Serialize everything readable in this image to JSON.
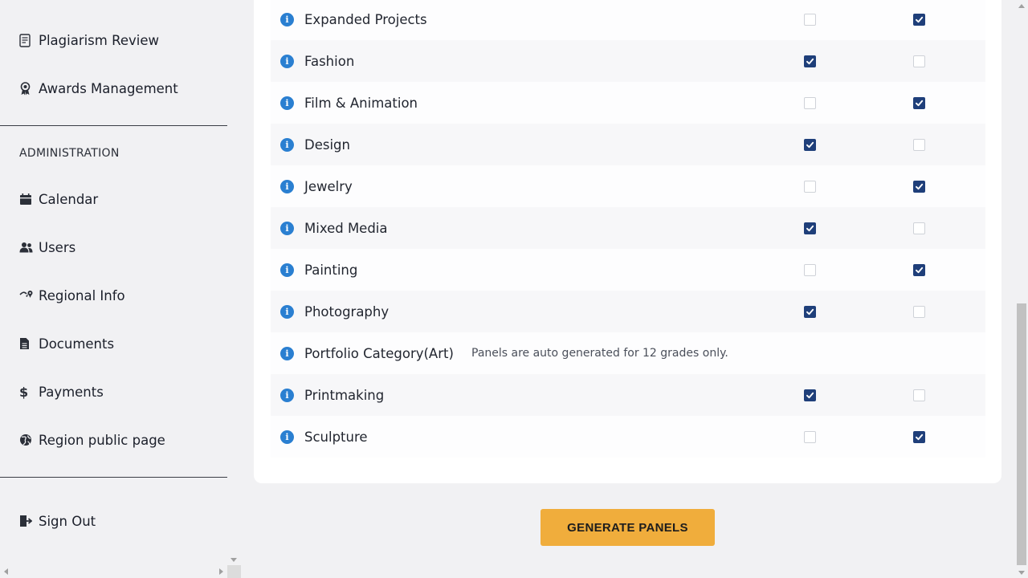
{
  "sidebar": {
    "top_items": [
      {
        "label": "Plagiarism Review",
        "icon": "document-check-icon"
      },
      {
        "label": "Awards Management",
        "icon": "award-ribbon-icon"
      }
    ],
    "admin_section_title": "ADMINISTRATION",
    "admin_items": [
      {
        "label": "Calendar",
        "icon": "calendar-icon"
      },
      {
        "label": "Users",
        "icon": "users-icon"
      },
      {
        "label": "Regional Info",
        "icon": "map-pin-icon"
      },
      {
        "label": "Documents",
        "icon": "document-icon"
      },
      {
        "label": "Payments",
        "icon": "dollar-icon"
      },
      {
        "label": "Region public page",
        "icon": "globe-icon"
      }
    ],
    "sign_out": {
      "label": "Sign Out",
      "icon": "sign-out-icon"
    }
  },
  "categories": [
    {
      "name": "Expanded Projects",
      "col1": false,
      "col2": true
    },
    {
      "name": "Fashion",
      "col1": true,
      "col2": false
    },
    {
      "name": "Film & Animation",
      "col1": false,
      "col2": true
    },
    {
      "name": "Design",
      "col1": true,
      "col2": false
    },
    {
      "name": "Jewelry",
      "col1": false,
      "col2": true
    },
    {
      "name": "Mixed Media",
      "col1": true,
      "col2": false
    },
    {
      "name": "Painting",
      "col1": false,
      "col2": true
    },
    {
      "name": "Photography",
      "col1": true,
      "col2": false
    },
    {
      "name": "Portfolio Category(Art)",
      "note": "Panels are auto generated for 12 grades only."
    },
    {
      "name": "Printmaking",
      "col1": true,
      "col2": false
    },
    {
      "name": "Sculpture",
      "col1": false,
      "col2": true
    }
  ],
  "generate_button": "GENERATE PANELS",
  "colors": {
    "accent": "#f0ad3c",
    "checkbox_checked": "#1f3f7a",
    "info_icon": "#2a7fd1"
  }
}
